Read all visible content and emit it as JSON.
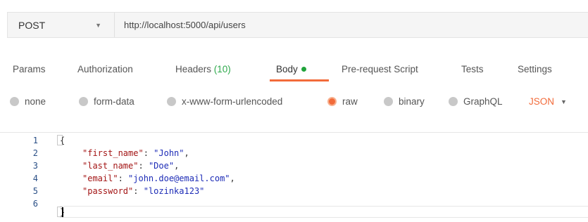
{
  "request": {
    "method": "POST",
    "url": "http://localhost:5000/api/users"
  },
  "tabs": {
    "params": "Params",
    "authorization": "Authorization",
    "headers_label": "Headers",
    "headers_count": "(10)",
    "body": "Body",
    "prerequest": "Pre-request Script",
    "tests": "Tests",
    "settings": "Settings"
  },
  "body_types": {
    "none": "none",
    "form_data": "form-data",
    "urlencoded": "x-www-form-urlencoded",
    "raw": "raw",
    "binary": "binary",
    "graphql": "GraphQL",
    "selected": "raw",
    "language": "JSON"
  },
  "editor": {
    "line_numbers": [
      "1",
      "2",
      "3",
      "4",
      "5",
      "6"
    ],
    "open_brace": "{",
    "close_brace": "}",
    "fields": [
      {
        "key": "\"first_name\"",
        "value": "\"John\"",
        "trail": ","
      },
      {
        "key": "\"last_name\"",
        "value": "\"Doe\"",
        "trail": ","
      },
      {
        "key": "\"email\"",
        "value": "\"john.doe@email.com\"",
        "trail": ","
      },
      {
        "key": "\"password\"",
        "value": "\"lozinka123\"",
        "trail": ""
      }
    ]
  },
  "colors": {
    "accent": "#f26b3a",
    "body_dot": "#20a33b",
    "headers_count": "#2eaa4c"
  }
}
